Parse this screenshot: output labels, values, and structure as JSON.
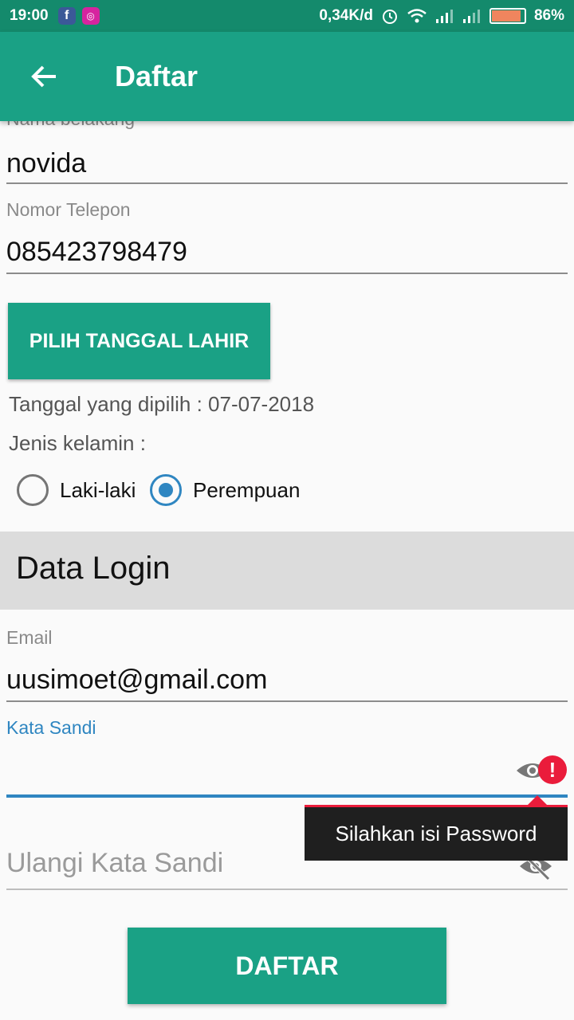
{
  "status_bar": {
    "time": "19:00",
    "network_speed": "0,34K/d",
    "battery_percent": "86%",
    "battery_level": 0.86,
    "notification_icons": [
      "facebook-icon",
      "instagram-icon"
    ],
    "status_icons": [
      "alarm-icon",
      "wifi-icon",
      "signal-icon",
      "signal-icon",
      "battery-icon"
    ]
  },
  "app_bar": {
    "title": "Daftar",
    "back_icon": "arrow-back-icon"
  },
  "form": {
    "last_name": {
      "label": "Nama belakang",
      "value": "novida"
    },
    "phone": {
      "label": "Nomor Telepon",
      "value": "085423798479"
    },
    "date_button_label": "PILIH TANGGAL LAHIR",
    "selected_date_text": "Tanggal yang dipilih : 07-07-2018",
    "gender_label": "Jenis kelamin :",
    "gender_options": [
      {
        "label": "Laki-laki",
        "checked": false
      },
      {
        "label": "Perempuan",
        "checked": true
      }
    ]
  },
  "login_section": {
    "title": "Data Login",
    "email": {
      "label": "Email",
      "value": "uusimoet@gmail.com"
    },
    "password": {
      "label": "Kata Sandi",
      "value": ""
    },
    "confirm_password": {
      "placeholder": "Ulangi Kata Sandi"
    },
    "error_tooltip": "Silahkan isi Password",
    "error_badge": "!"
  },
  "submit_button_label": "DAFTAR",
  "colors": {
    "primary": "#1aa185",
    "primary_dark": "#148a6c",
    "accent": "#2f86c1",
    "error": "#ea1c3b"
  }
}
